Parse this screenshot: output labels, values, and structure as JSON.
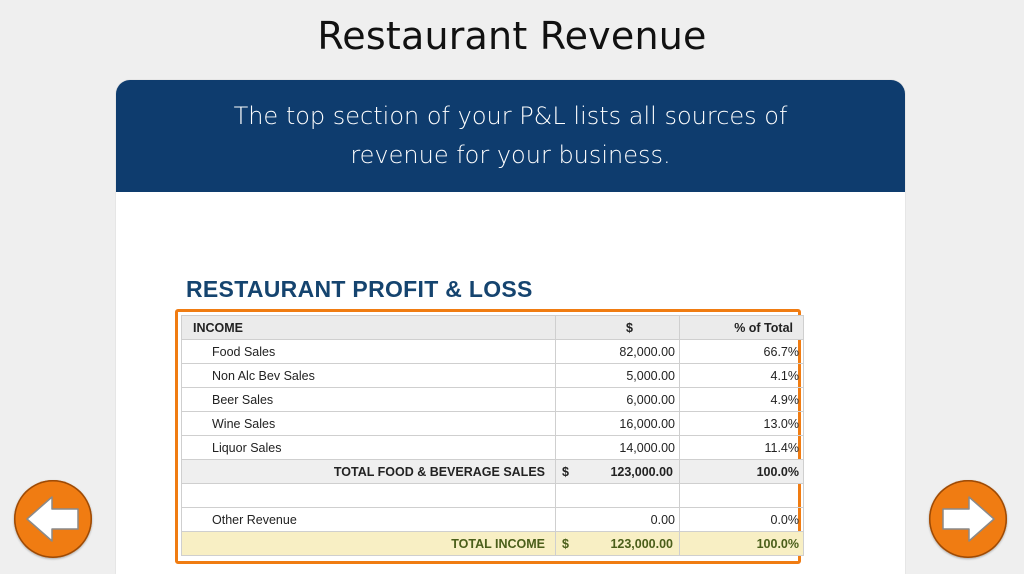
{
  "slide": {
    "title": "Restaurant Revenue",
    "banner": "The top section of your P&L lists all sources of revenue for your business."
  },
  "report": {
    "title": "RESTAURANT PROFIT & LOSS",
    "header": {
      "label": "INCOME",
      "amount": "$",
      "percent": "% of Total"
    },
    "items": [
      {
        "label": "Food Sales",
        "amount": "82,000.00",
        "percent": "66.7%"
      },
      {
        "label": "Non Alc Bev Sales",
        "amount": "5,000.00",
        "percent": "4.1%"
      },
      {
        "label": "Beer Sales",
        "amount": "6,000.00",
        "percent": "4.9%"
      },
      {
        "label": "Wine Sales",
        "amount": "16,000.00",
        "percent": "13.0%"
      },
      {
        "label": "Liquor Sales",
        "amount": "14,000.00",
        "percent": "11.4%"
      }
    ],
    "subtotal": {
      "label": "TOTAL FOOD & BEVERAGE SALES",
      "currency": "$",
      "amount": "123,000.00",
      "percent": "100.0%"
    },
    "other": {
      "label": "Other Revenue",
      "amount": "0.00",
      "percent": "0.0%"
    },
    "total": {
      "label": "TOTAL INCOME",
      "currency": "$",
      "amount": "123,000.00",
      "percent": "100.0%"
    }
  },
  "nav": {
    "prev_icon": "arrow-left-icon",
    "next_icon": "arrow-right-icon"
  },
  "colors": {
    "banner": "#0e3c6e",
    "heading": "#15446f",
    "accent": "#f07c12",
    "total_bg": "#f8efc4",
    "total_text": "#4a5e1a"
  }
}
